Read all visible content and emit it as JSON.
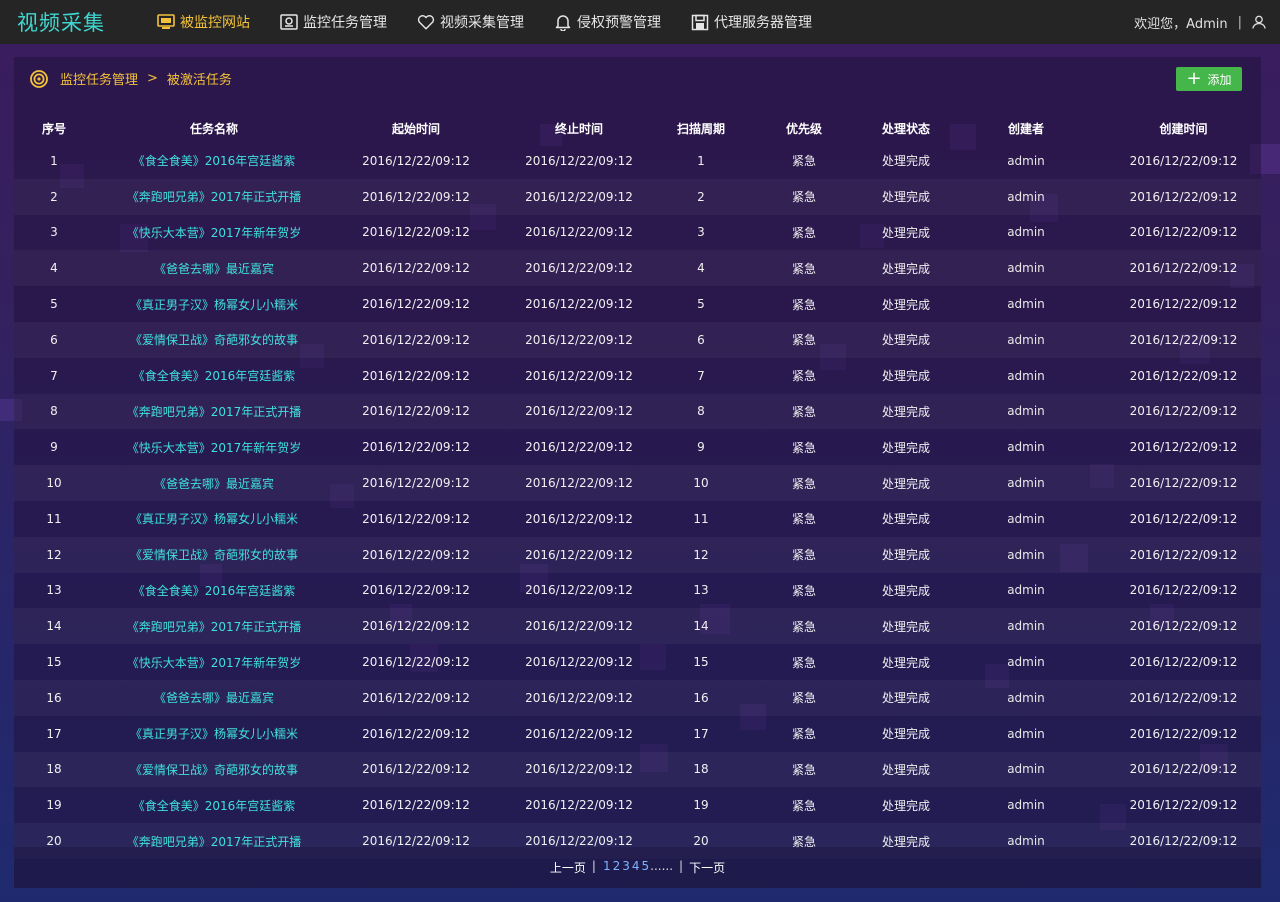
{
  "app": {
    "title": "视频采集"
  },
  "nav": [
    {
      "label": "被监控网站",
      "icon": "monitor-icon",
      "active": true
    },
    {
      "label": "监控任务管理",
      "icon": "task-monitor-icon",
      "active": false
    },
    {
      "label": "视频采集管理",
      "icon": "heart-icon",
      "active": false
    },
    {
      "label": "侵权预警管理",
      "icon": "bell-icon",
      "active": false
    },
    {
      "label": "代理服务器管理",
      "icon": "server-icon",
      "active": false
    }
  ],
  "user": {
    "greeting": "欢迎您，Admin",
    "separator": "|"
  },
  "breadcrumb": {
    "parent": "监控任务管理",
    "arrow": ">",
    "current": "被激活任务"
  },
  "toolbar": {
    "add_label": "添加"
  },
  "table": {
    "columns": [
      "序号",
      "任务名称",
      "起始时间",
      "终止时间",
      "扫描周期",
      "优先级",
      "处理状态",
      "创建者",
      "创建时间"
    ],
    "rows": [
      [
        "1",
        "《食全食美》2016年宫廷酱紫",
        "2016/12/22/09:12",
        "2016/12/22/09:12",
        "1",
        "紧急",
        "处理完成",
        "admin",
        "2016/12/22/09:12"
      ],
      [
        "2",
        "《奔跑吧兄弟》2017年正式开播",
        "2016/12/22/09:12",
        "2016/12/22/09:12",
        "2",
        "紧急",
        "处理完成",
        "admin",
        "2016/12/22/09:12"
      ],
      [
        "3",
        "《快乐大本营》2017年新年贺岁",
        "2016/12/22/09:12",
        "2016/12/22/09:12",
        "3",
        "紧急",
        "处理完成",
        "admin",
        "2016/12/22/09:12"
      ],
      [
        "4",
        "《爸爸去哪》最近嘉宾",
        "2016/12/22/09:12",
        "2016/12/22/09:12",
        "4",
        "紧急",
        "处理完成",
        "admin",
        "2016/12/22/09:12"
      ],
      [
        "5",
        "《真正男子汉》杨幂女儿小糯米",
        "2016/12/22/09:12",
        "2016/12/22/09:12",
        "5",
        "紧急",
        "处理完成",
        "admin",
        "2016/12/22/09:12"
      ],
      [
        "6",
        "《爱情保卫战》奇葩邪女的故事",
        "2016/12/22/09:12",
        "2016/12/22/09:12",
        "6",
        "紧急",
        "处理完成",
        "admin",
        "2016/12/22/09:12"
      ],
      [
        "7",
        "《食全食美》2016年宫廷酱紫",
        "2016/12/22/09:12",
        "2016/12/22/09:12",
        "7",
        "紧急",
        "处理完成",
        "admin",
        "2016/12/22/09:12"
      ],
      [
        "8",
        "《奔跑吧兄弟》2017年正式开播",
        "2016/12/22/09:12",
        "2016/12/22/09:12",
        "8",
        "紧急",
        "处理完成",
        "admin",
        "2016/12/22/09:12"
      ],
      [
        "9",
        "《快乐大本营》2017年新年贺岁",
        "2016/12/22/09:12",
        "2016/12/22/09:12",
        "9",
        "紧急",
        "处理完成",
        "admin",
        "2016/12/22/09:12"
      ],
      [
        "10",
        "《爸爸去哪》最近嘉宾",
        "2016/12/22/09:12",
        "2016/12/22/09:12",
        "10",
        "紧急",
        "处理完成",
        "admin",
        "2016/12/22/09:12"
      ],
      [
        "11",
        "《真正男子汉》杨幂女儿小糯米",
        "2016/12/22/09:12",
        "2016/12/22/09:12",
        "11",
        "紧急",
        "处理完成",
        "admin",
        "2016/12/22/09:12"
      ],
      [
        "12",
        "《爱情保卫战》奇葩邪女的故事",
        "2016/12/22/09:12",
        "2016/12/22/09:12",
        "12",
        "紧急",
        "处理完成",
        "admin",
        "2016/12/22/09:12"
      ],
      [
        "13",
        "《食全食美》2016年宫廷酱紫",
        "2016/12/22/09:12",
        "2016/12/22/09:12",
        "13",
        "紧急",
        "处理完成",
        "admin",
        "2016/12/22/09:12"
      ],
      [
        "14",
        "《奔跑吧兄弟》2017年正式开播",
        "2016/12/22/09:12",
        "2016/12/22/09:12",
        "14",
        "紧急",
        "处理完成",
        "admin",
        "2016/12/22/09:12"
      ],
      [
        "15",
        "《快乐大本营》2017年新年贺岁",
        "2016/12/22/09:12",
        "2016/12/22/09:12",
        "15",
        "紧急",
        "处理完成",
        "admin",
        "2016/12/22/09:12"
      ],
      [
        "16",
        "《爸爸去哪》最近嘉宾",
        "2016/12/22/09:12",
        "2016/12/22/09:12",
        "16",
        "紧急",
        "处理完成",
        "admin",
        "2016/12/22/09:12"
      ],
      [
        "17",
        "《真正男子汉》杨幂女儿小糯米",
        "2016/12/22/09:12",
        "2016/12/22/09:12",
        "17",
        "紧急",
        "处理完成",
        "admin",
        "2016/12/22/09:12"
      ],
      [
        "18",
        "《爱情保卫战》奇葩邪女的故事",
        "2016/12/22/09:12",
        "2016/12/22/09:12",
        "18",
        "紧急",
        "处理完成",
        "admin",
        "2016/12/22/09:12"
      ],
      [
        "19",
        "《食全食美》2016年宫廷酱紫",
        "2016/12/22/09:12",
        "2016/12/22/09:12",
        "19",
        "紧急",
        "处理完成",
        "admin",
        "2016/12/22/09:12"
      ],
      [
        "20",
        "《奔跑吧兄弟》2017年正式开播",
        "2016/12/22/09:12",
        "2016/12/22/09:12",
        "20",
        "紧急",
        "处理完成",
        "admin",
        "2016/12/22/09:12"
      ]
    ]
  },
  "pagination": {
    "prev": "上一页",
    "pages": [
      "1",
      "2",
      "3",
      "4",
      "5"
    ],
    "ellipsis": "......",
    "next": "下一页"
  },
  "colors": {
    "accent": "#f3c23a",
    "link": "#3fe0dc",
    "add_button": "#45b64a",
    "topbar": "#252525"
  }
}
